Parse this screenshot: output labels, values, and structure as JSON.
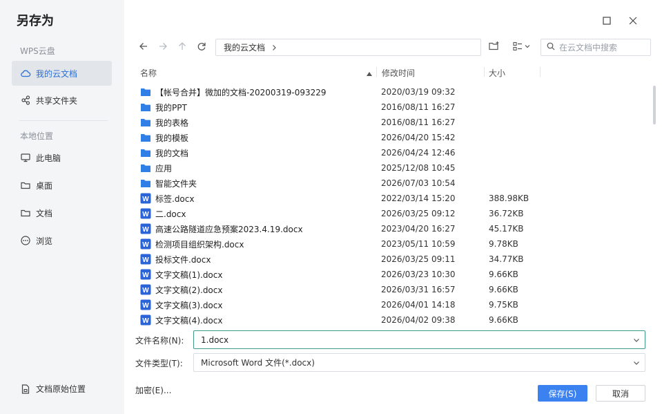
{
  "dialog": {
    "title": "另存为"
  },
  "sidebar": {
    "section_cloud": "WPS云盘",
    "cloud_items": [
      {
        "label": "我的云文档",
        "icon": "cloud-icon",
        "active": true
      },
      {
        "label": "共享文件夹",
        "icon": "share-folder-icon",
        "active": false
      }
    ],
    "section_local": "本地位置",
    "local_items": [
      {
        "label": "此电脑",
        "icon": "computer-icon"
      },
      {
        "label": "桌面",
        "icon": "folder-outline-icon"
      },
      {
        "label": "文档",
        "icon": "folder-outline-icon"
      },
      {
        "label": "浏览",
        "icon": "more-icon"
      }
    ],
    "bottom_item": {
      "label": "文档原始位置",
      "icon": "document-location-icon"
    }
  },
  "toolbar": {
    "breadcrumb": "我的云文档",
    "search_placeholder": "在云文档中搜索"
  },
  "columns": {
    "name": "名称",
    "modified": "修改时间",
    "size": "大小"
  },
  "files": [
    {
      "name": "【帐号合并】微加的文档-20200319-093229",
      "modified": "2020/03/19 09:32",
      "size": "",
      "type": "folder"
    },
    {
      "name": "我的PPT",
      "modified": "2016/08/11 16:27",
      "size": "",
      "type": "folder"
    },
    {
      "name": "我的表格",
      "modified": "2016/08/11 16:27",
      "size": "",
      "type": "folder"
    },
    {
      "name": "我的模板",
      "modified": "2026/04/20 15:42",
      "size": "",
      "type": "folder"
    },
    {
      "name": "我的文档",
      "modified": "2026/04/24 12:46",
      "size": "",
      "type": "folder"
    },
    {
      "name": "应用",
      "modified": "2025/12/08 10:45",
      "size": "",
      "type": "folder"
    },
    {
      "name": "智能文件夹",
      "modified": "2026/07/03 10:54",
      "size": "",
      "type": "folder"
    },
    {
      "name": "标签.docx",
      "modified": "2022/03/14 15:20",
      "size": "388.98KB",
      "type": "docx"
    },
    {
      "name": "二.docx",
      "modified": "2026/03/25 09:12",
      "size": "36.72KB",
      "type": "docx"
    },
    {
      "name": "高速公路隧道应急预案2023.4.19.docx",
      "modified": "2023/04/20 16:27",
      "size": "45.17KB",
      "type": "docx"
    },
    {
      "name": "检测项目组织架构.docx",
      "modified": "2023/05/11 10:59",
      "size": "9.78KB",
      "type": "docx"
    },
    {
      "name": "投标文件.docx",
      "modified": "2026/03/25 09:11",
      "size": "34.77KB",
      "type": "docx"
    },
    {
      "name": "文字文稿(1).docx",
      "modified": "2026/03/23 10:30",
      "size": "9.66KB",
      "type": "docx"
    },
    {
      "name": "文字文稿(2).docx",
      "modified": "2026/03/31 16:57",
      "size": "9.66KB",
      "type": "docx"
    },
    {
      "name": "文字文稿(3).docx",
      "modified": "2026/04/01 14:18",
      "size": "9.75KB",
      "type": "docx"
    },
    {
      "name": "文字文稿(4).docx",
      "modified": "2026/04/02 09:38",
      "size": "9.66KB",
      "type": "docx"
    }
  ],
  "form": {
    "filename_label": "文件名称(N):",
    "filename_value": "1.docx",
    "filetype_label": "文件类型(T):",
    "filetype_value": "Microsoft Word 文件(*.docx)"
  },
  "footer": {
    "encrypt": "加密(E)...",
    "save": "保存(S)",
    "cancel": "取消"
  },
  "colors": {
    "accent": "#3b82f0",
    "folder": "#2f7fe6",
    "docx": "#2b64d8",
    "input_focus": "#3d9a8b"
  }
}
